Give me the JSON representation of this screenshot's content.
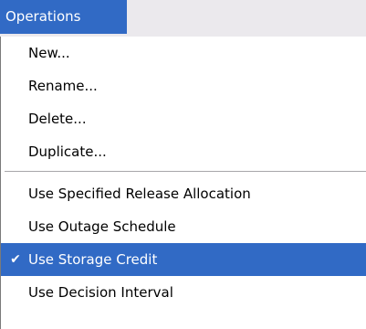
{
  "menubar": {
    "title": "Operations"
  },
  "menu": {
    "group1": [
      {
        "label": "New..."
      },
      {
        "label": "Rename..."
      },
      {
        "label": "Delete..."
      },
      {
        "label": "Duplicate..."
      }
    ],
    "group2": [
      {
        "label": "Use Specified Release Allocation",
        "checked": false
      },
      {
        "label": "Use Outage Schedule",
        "checked": false
      },
      {
        "label": "Use Storage Credit",
        "checked": true,
        "highlighted": true
      },
      {
        "label": "Use Decision Interval",
        "checked": false
      }
    ],
    "check_glyph": "✔"
  },
  "colors": {
    "highlight": "#316ac5",
    "menubar_bg": "#ebe9ed"
  }
}
